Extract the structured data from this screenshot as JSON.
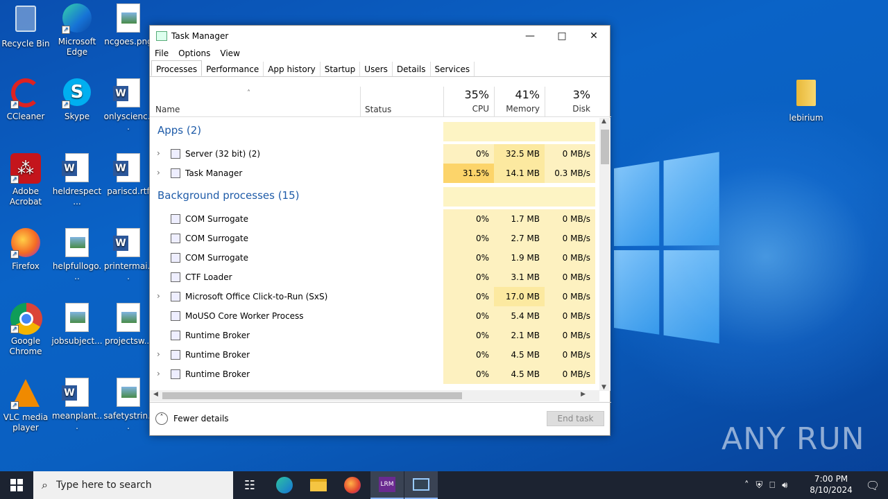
{
  "desktop": {
    "icons": [
      {
        "label": "Recycle Bin",
        "icon": "recycle-bin-icon"
      },
      {
        "label": "Microsoft Edge",
        "icon": "edge-icon"
      },
      {
        "label": "ncgoes.png",
        "icon": "image-file-icon"
      },
      {
        "label": "CCleaner",
        "icon": "ccleaner-icon"
      },
      {
        "label": "Skype",
        "icon": "skype-icon"
      },
      {
        "label": "onlyscienc...",
        "icon": "word-doc-icon"
      },
      {
        "label": "Adobe Acrobat",
        "icon": "acrobat-icon"
      },
      {
        "label": "heldrespect...",
        "icon": "word-doc-icon"
      },
      {
        "label": "pariscd.rtf",
        "icon": "word-doc-icon"
      },
      {
        "label": "Firefox",
        "icon": "firefox-icon"
      },
      {
        "label": "helpfullogo...",
        "icon": "image-file-icon"
      },
      {
        "label": "printermai...",
        "icon": "word-doc-icon"
      },
      {
        "label": "Google Chrome",
        "icon": "chrome-icon"
      },
      {
        "label": "jobsubject...",
        "icon": "image-file-icon"
      },
      {
        "label": "projectsw...",
        "icon": "image-file-icon"
      },
      {
        "label": "VLC media player",
        "icon": "vlc-icon"
      },
      {
        "label": "meanplant...",
        "icon": "word-doc-icon"
      },
      {
        "label": "safetystrin...",
        "icon": "image-file-icon"
      },
      {
        "label": "lebirium",
        "icon": "folder-icon"
      }
    ],
    "watermark": "ANY RUN"
  },
  "task_manager": {
    "title": "Task Manager",
    "menu": [
      "File",
      "Options",
      "View"
    ],
    "tabs": [
      "Processes",
      "Performance",
      "App history",
      "Startup",
      "Users",
      "Details",
      "Services"
    ],
    "active_tab": "Processes",
    "columns": {
      "name": "Name",
      "status": "Status",
      "cpu": {
        "pct": "35%",
        "label": "CPU"
      },
      "memory": {
        "pct": "41%",
        "label": "Memory"
      },
      "disk": {
        "pct": "3%",
        "label": "Disk"
      }
    },
    "groups": {
      "apps": "Apps (2)",
      "background": "Background processes (15)"
    },
    "apps": [
      {
        "name": "Server (32 bit) (2)",
        "cpu": "0%",
        "memory": "32.5 MB",
        "disk": "0 MB/s",
        "expandable": true
      },
      {
        "name": "Task Manager",
        "cpu": "31.5%",
        "memory": "14.1 MB",
        "disk": "0.3 MB/s",
        "expandable": true
      }
    ],
    "background": [
      {
        "name": "COM Surrogate",
        "cpu": "0%",
        "memory": "1.7 MB",
        "disk": "0 MB/s",
        "expandable": false
      },
      {
        "name": "COM Surrogate",
        "cpu": "0%",
        "memory": "2.7 MB",
        "disk": "0 MB/s",
        "expandable": false
      },
      {
        "name": "COM Surrogate",
        "cpu": "0%",
        "memory": "1.9 MB",
        "disk": "0 MB/s",
        "expandable": false
      },
      {
        "name": "CTF Loader",
        "cpu": "0%",
        "memory": "3.1 MB",
        "disk": "0 MB/s",
        "expandable": false
      },
      {
        "name": "Microsoft Office Click-to-Run (SxS)",
        "cpu": "0%",
        "memory": "17.0 MB",
        "disk": "0 MB/s",
        "expandable": true
      },
      {
        "name": "MoUSO Core Worker Process",
        "cpu": "0%",
        "memory": "5.4 MB",
        "disk": "0 MB/s",
        "expandable": false
      },
      {
        "name": "Runtime Broker",
        "cpu": "0%",
        "memory": "2.1 MB",
        "disk": "0 MB/s",
        "expandable": false
      },
      {
        "name": "Runtime Broker",
        "cpu": "0%",
        "memory": "4.5 MB",
        "disk": "0 MB/s",
        "expandable": true
      },
      {
        "name": "Runtime Broker",
        "cpu": "0%",
        "memory": "4.5 MB",
        "disk": "0 MB/s",
        "expandable": true
      }
    ],
    "footer": {
      "fewer_details": "Fewer details",
      "end_task": "End task"
    }
  },
  "taskbar": {
    "search_placeholder": "Type here to search",
    "time": "7:00 PM",
    "date": "8/10/2024"
  }
}
